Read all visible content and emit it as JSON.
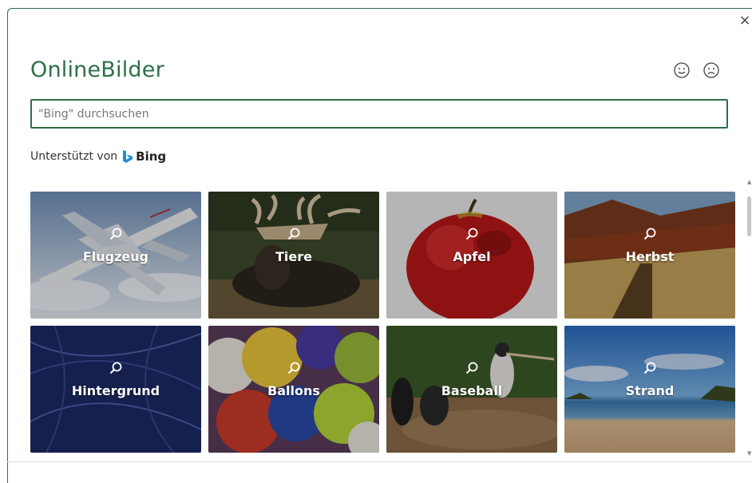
{
  "dialog": {
    "title": "OnlineBilder",
    "close_label": "×"
  },
  "search": {
    "placeholder": "\"Bing\" durchsuchen",
    "value": ""
  },
  "powered_by": {
    "text": "Unterstützt von",
    "brand": "Bing"
  },
  "categories": [
    {
      "label": "Flugzeug"
    },
    {
      "label": "Tiere"
    },
    {
      "label": "Apfel"
    },
    {
      "label": "Herbst"
    },
    {
      "label": "Hintergrund"
    },
    {
      "label": "Ballons"
    },
    {
      "label": "Baseball"
    },
    {
      "label": "Strand"
    }
  ],
  "colors": {
    "accent": "#2e7047",
    "bing_blue": "#1b8fd8"
  }
}
